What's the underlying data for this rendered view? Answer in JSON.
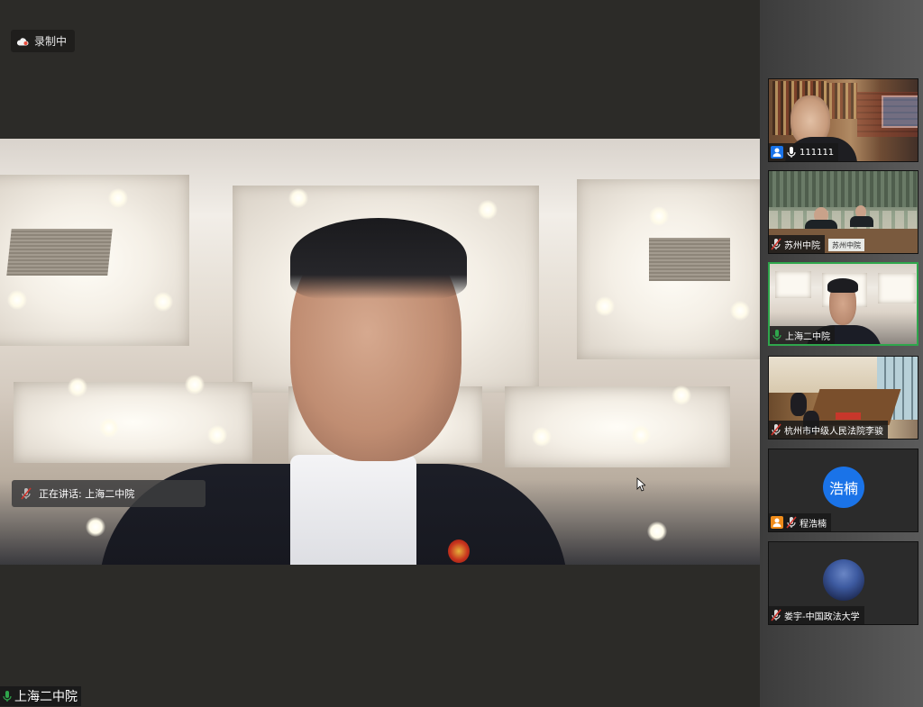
{
  "recording": {
    "label": "录制中",
    "icon": "cloud-icon"
  },
  "main_video": {
    "speaking_label": "正在讲话: 上海二中院",
    "speaker_icon": "mic-muted-icon"
  },
  "bottom_label": {
    "name": "上海二中院",
    "icon": "mic-active-icon"
  },
  "participants": [
    {
      "name": "111111",
      "icons": [
        "person-icon",
        "mic-icon"
      ]
    },
    {
      "name": "苏州中院",
      "icons": [
        "mic-muted-icon"
      ],
      "sign_text": "苏州中院"
    },
    {
      "name": "上海二中院",
      "icons": [
        "mic-active-icon"
      ],
      "active": true
    },
    {
      "name": "杭州市中级人民法院李骏",
      "icons": [
        "mic-muted-icon"
      ]
    },
    {
      "name": "程浩楠",
      "icons": [
        "host-icon",
        "mic-muted-icon"
      ],
      "avatar_text": "浩楠",
      "avatar_color": "#1a73e8"
    },
    {
      "name": "娄宇-中国政法大学",
      "icons": [
        "mic-muted-icon"
      ]
    }
  ],
  "colors": {
    "active_border": "#2fa64c",
    "avatar_blue": "#1a73e8",
    "muted_red": "#d0342c"
  }
}
